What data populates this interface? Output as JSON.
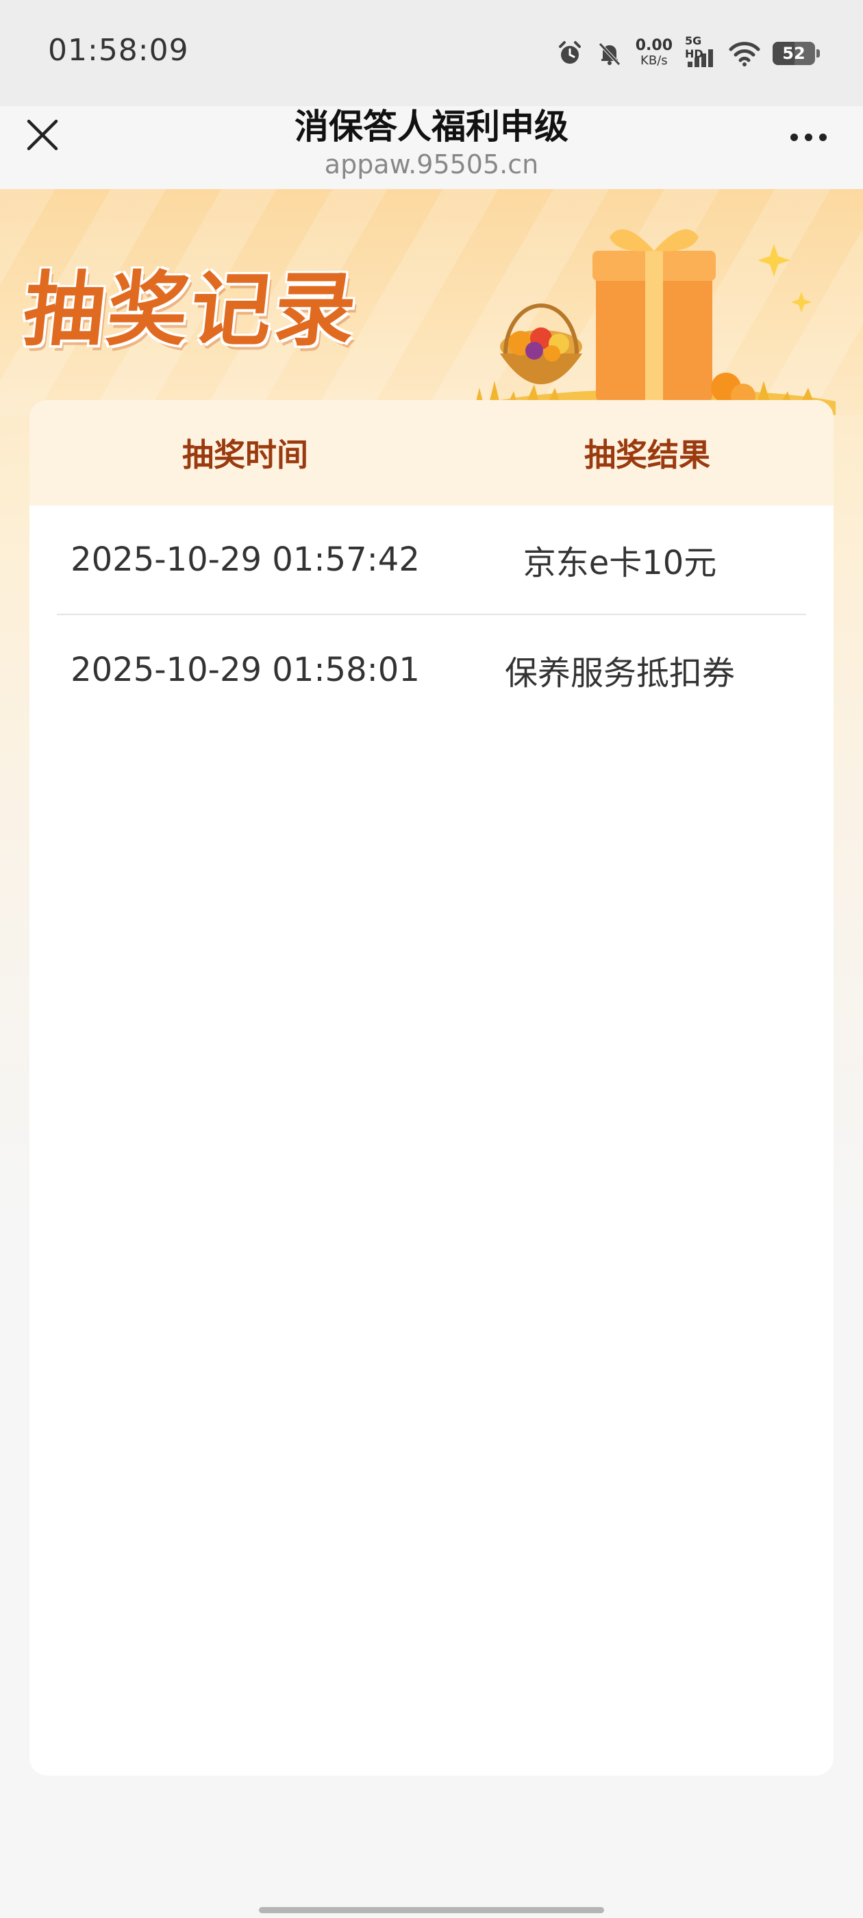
{
  "status_bar": {
    "time": "01:58:09",
    "net_speed_value": "0.00",
    "net_speed_unit": "KB/s",
    "signal_label": "5G HD",
    "battery_level": "52",
    "icons": [
      "alarm-icon",
      "bell-muted-icon",
      "signal-icon",
      "wifi-icon",
      "battery-icon"
    ]
  },
  "nav": {
    "title": "消保答人福利申级",
    "url": "appaw.95505.cn",
    "close_icon": "close-icon",
    "more_icon": "more-icon"
  },
  "banner": {
    "title": "抽奖记录"
  },
  "table": {
    "headers": [
      "抽奖时间",
      "抽奖结果"
    ],
    "rows": [
      {
        "time": "2025-10-29 01:57:42",
        "result": "京东e卡10元"
      },
      {
        "time": "2025-10-29 01:58:01",
        "result": "保养服务抵扣券"
      }
    ]
  },
  "colors": {
    "accent": "#e06a20",
    "header_text": "#9a3a0e",
    "header_bg": "#fef3e1"
  }
}
